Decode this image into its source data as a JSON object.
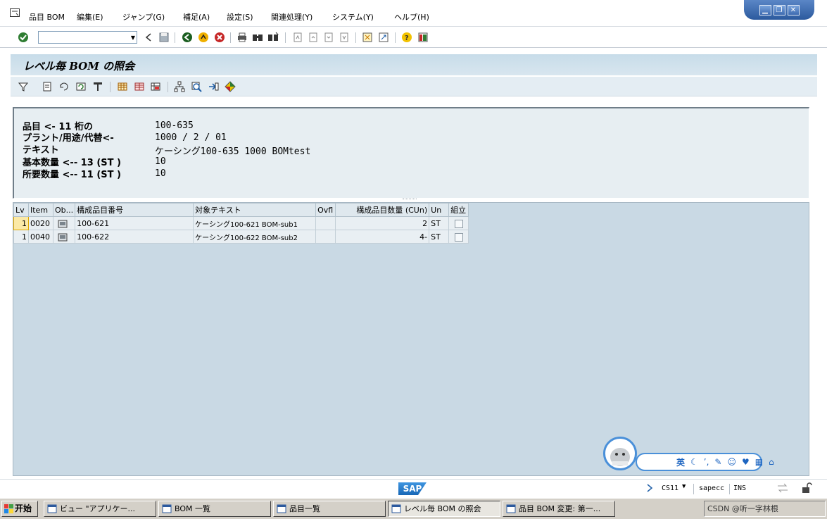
{
  "menu": {
    "items": [
      "品目 BOM",
      "編集(E)",
      "ジャンプ(G)",
      "補足(A)",
      "設定(S)",
      "関連処理(Y)",
      "システム(Y)",
      "ヘルプ(H)"
    ]
  },
  "window_controls": {
    "minimize": "▁",
    "restore": "❐",
    "close": "✕"
  },
  "command_field": {
    "value": ""
  },
  "page": {
    "title": "レベル毎 BOM の照会"
  },
  "header": {
    "material_label": "品目 <- 11 桁の",
    "material_value": "100-635",
    "plant_label": "プラント/用途/代替<-",
    "plant_value": "1000 / 2 / 01",
    "text_label": "テキスト",
    "text_value": "ケーシング100-635 1000 BOMtest",
    "base_qty_label": "基本数量 <-- 13 (ST )",
    "base_qty_value": "10",
    "req_qty_label": "所要数量 <-- 11 (ST )",
    "req_qty_value": "10"
  },
  "grid": {
    "headers": {
      "lv": "Lv",
      "item": "Item",
      "ob": "Ob...",
      "component": "構成品目番号",
      "text": "対象テキスト",
      "ovfl": "Ovfl",
      "qty": "構成品目数量 (CUn)",
      "un": "Un",
      "asm": "組立"
    },
    "rows": [
      {
        "lv": "1",
        "item": "0020",
        "component": "100-621",
        "text": "ケーシング100-621 BOM-sub1",
        "ovfl": "",
        "qty": "2",
        "un": "ST",
        "asm": false
      },
      {
        "lv": "1",
        "item": "0040",
        "component": "100-622",
        "text": "ケーシング100-622 BOM-sub2",
        "ovfl": "",
        "qty": "4-",
        "un": "ST",
        "asm": false
      }
    ]
  },
  "ime": {
    "mode_label": "英"
  },
  "status": {
    "sap_logo": "SAP",
    "transaction": "CS11",
    "server": "sapecc",
    "mode": "INS"
  },
  "taskbar": {
    "start_label": "开始",
    "tasks": [
      "ビュー \"アプリケー...",
      "BOM 一覧",
      "品目一覧",
      "レベル毎 BOM の照会",
      "品目 BOM 変更: 第一..."
    ],
    "tray_text": "CSDN @听一字林根"
  },
  "colors": {
    "titlebar": "#c7dce9",
    "grid_bg": "#c9d9e4",
    "selected_cell": "#fbe9a6",
    "sap_blue": "#1867b6"
  }
}
